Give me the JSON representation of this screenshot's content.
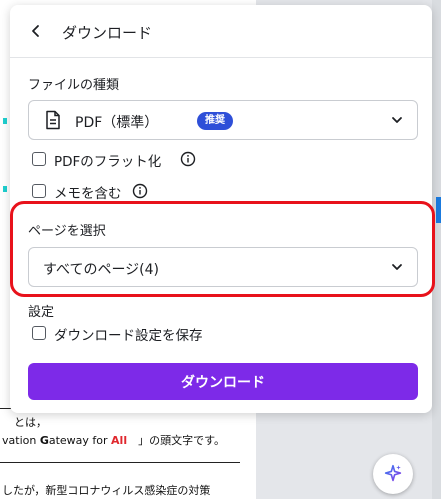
{
  "panel": {
    "title": "ダウンロード",
    "file_type": {
      "label": "ファイルの種類",
      "selected": "PDF（標準）",
      "badge": "推奨"
    },
    "options": [
      {
        "label": "PDFのフラット化",
        "checked": false
      },
      {
        "label": "メモを含む",
        "checked": false
      }
    ],
    "page_select": {
      "label": "ページを選択",
      "selected": "すべてのページ(4)"
    },
    "settings": {
      "label": "設定",
      "save_label": "ダウンロード設定を保存",
      "checked": false
    },
    "download_button": "ダウンロード"
  },
  "document": {
    "line1": "とは，",
    "line2_pre": "vation ",
    "line2_g": "G",
    "line2_mid": "ateway for ",
    "line2_all": "All",
    "line2_post": "　」の頭文字です。",
    "line3": "したが，新型コロナウィルス感染症の対策"
  },
  "colors": {
    "accent": "#7d2ae8",
    "badge": "#2e4fd8",
    "highlight": "#e8121b"
  }
}
